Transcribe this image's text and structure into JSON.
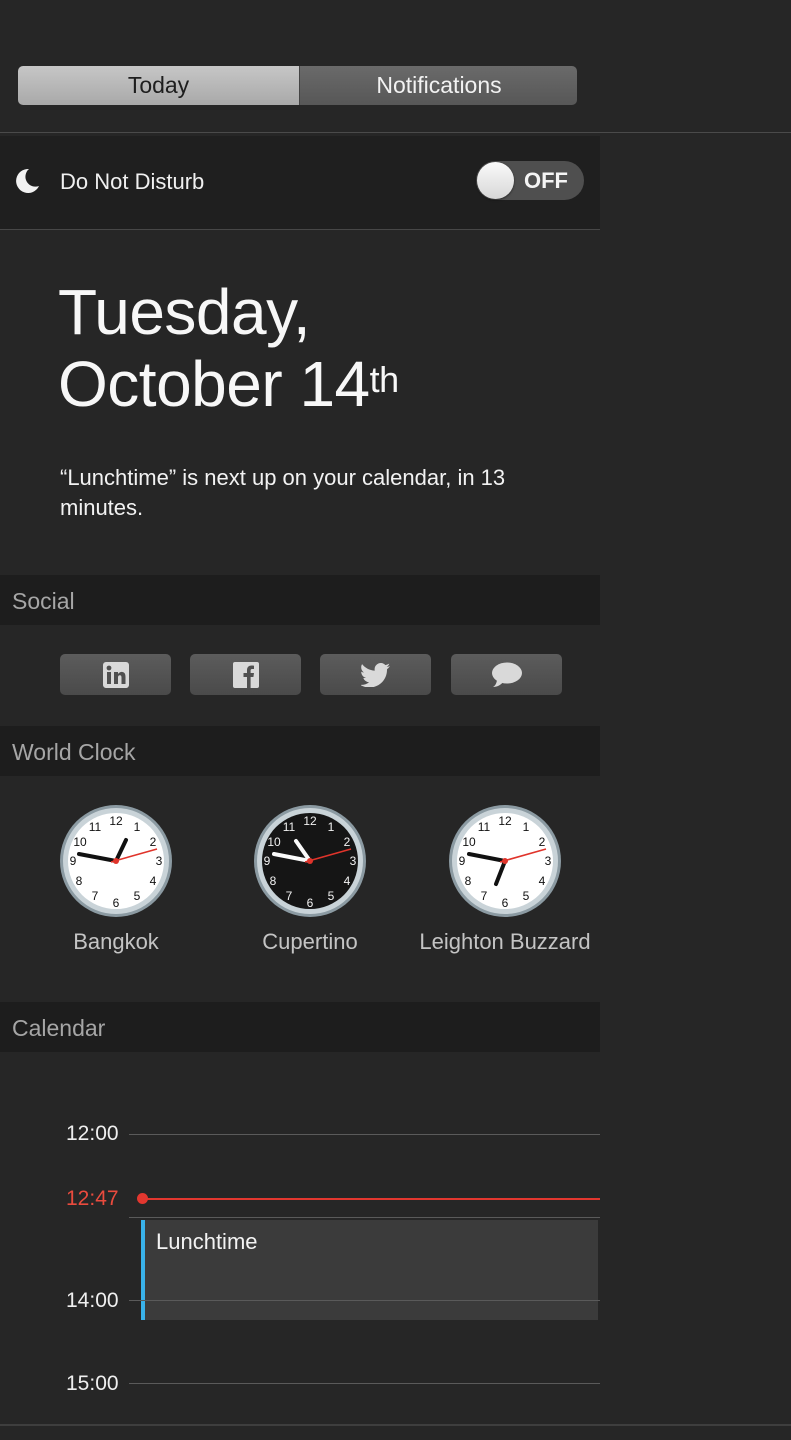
{
  "tabs": {
    "today": "Today",
    "notifications": "Notifications"
  },
  "dnd": {
    "label": "Do Not Disturb",
    "toggle_state": "OFF",
    "icon": "moon-icon"
  },
  "date": {
    "weekday_line": "Tuesday,",
    "month_day": "October 14",
    "suffix": "th"
  },
  "next_up": "“Lunchtime” is next up on your calendar, in 13 minutes.",
  "social": {
    "title": "Social",
    "buttons": [
      {
        "icon": "linkedin-icon"
      },
      {
        "icon": "facebook-icon"
      },
      {
        "icon": "twitter-icon"
      },
      {
        "icon": "messages-icon"
      }
    ]
  },
  "world_clock": {
    "title": "World Clock",
    "clocks": [
      {
        "city": "Bangkok",
        "face": "light"
      },
      {
        "city": "Cupertino",
        "face": "dark"
      },
      {
        "city": "Leighton Buzzard",
        "face": "light"
      }
    ]
  },
  "calendar": {
    "title": "Calendar",
    "times": [
      "12:00",
      "14:00",
      "15:00"
    ],
    "now": "12:47",
    "event": "Lunchtime"
  },
  "colors": {
    "now_line": "#e2372f",
    "event_accent": "#39b2ea"
  }
}
